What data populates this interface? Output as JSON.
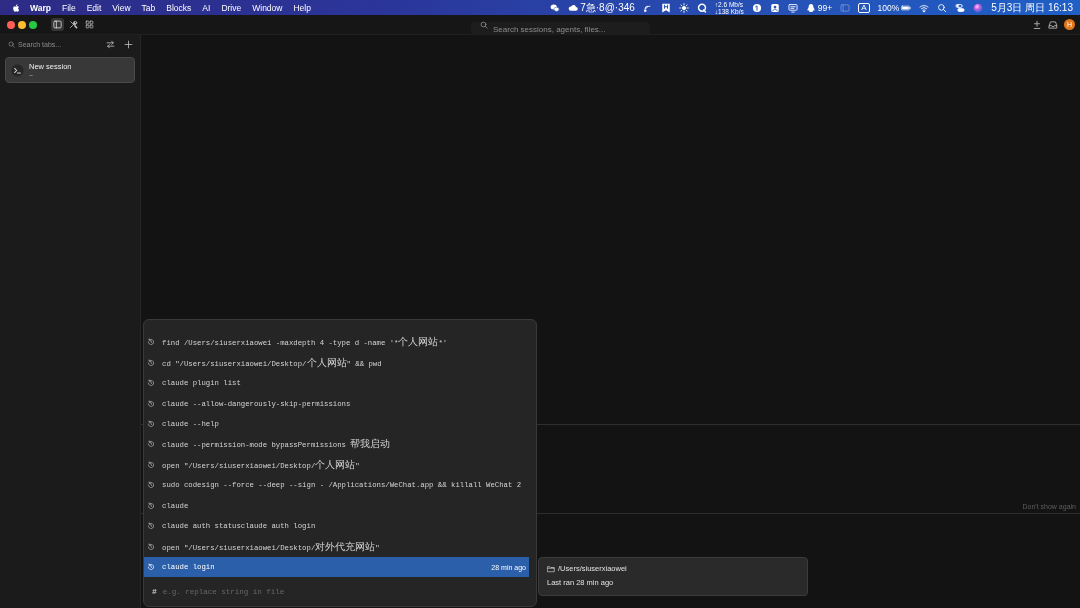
{
  "menu_bar": {
    "app_name": "Warp",
    "menus": [
      "File",
      "Edit",
      "View",
      "Tab",
      "Blocks",
      "AI",
      "Drive",
      "Window",
      "Help"
    ],
    "status": {
      "message_counter": "7急·8@·346",
      "upload_speed": "↑2.6 Mb/s",
      "download_speed": "↓138 Kb/s",
      "notification_count": "99+",
      "input_source": "A",
      "battery_percent": "100%",
      "clock": "5月3日 周日 16:13"
    }
  },
  "toolbar": {
    "sidebar_toggle": {
      "on": true
    },
    "search": {
      "placeholder": "Search sessions, agents, files..."
    },
    "avatar_initial": "H"
  },
  "sidebar": {
    "search": {
      "placeholder": "Search tabs..."
    },
    "sessions": [
      {
        "title": "New session",
        "subtitle": "~",
        "selected": true
      }
    ]
  },
  "banner": {
    "dismiss_link": "Don't show again"
  },
  "history_menu": {
    "items": [
      {
        "command": "find /Users/siuserxiaowei -maxdepth 4 -type d -name '*个人网站*'",
        "selected": false
      },
      {
        "command": "cd \"/Users/siuserxiaowei/Desktop/个人网站\" && pwd",
        "selected": false
      },
      {
        "command": "claude plugin list",
        "selected": false
      },
      {
        "command": "claude --allow-dangerously-skip-permissions",
        "selected": false
      },
      {
        "command": "claude --help",
        "selected": false
      },
      {
        "command": "claude --permission-mode bypassPermissions 帮我启动",
        "selected": false
      },
      {
        "command": "open \"/Users/siuserxiaowei/Desktop/个人网站\"",
        "selected": false
      },
      {
        "command": "sudo codesign --force --deep --sign - /Applications/WeChat.app && killall WeChat 2",
        "selected": false
      },
      {
        "command": "claude",
        "selected": false
      },
      {
        "command": "claude auth statusclaude auth login",
        "selected": false
      },
      {
        "command": "open \"/Users/siuserxiaowei/Desktop/对外代充网站\"",
        "selected": false
      },
      {
        "command": "claude login",
        "selected": true,
        "time": "28 min ago"
      }
    ],
    "input": {
      "prompt_symbol": "#",
      "placeholder": "e.g. replace string in file"
    }
  },
  "tooltip": {
    "path": "/Users/siuserxiaowei",
    "last_ran": "Last ran 28 min ago"
  }
}
